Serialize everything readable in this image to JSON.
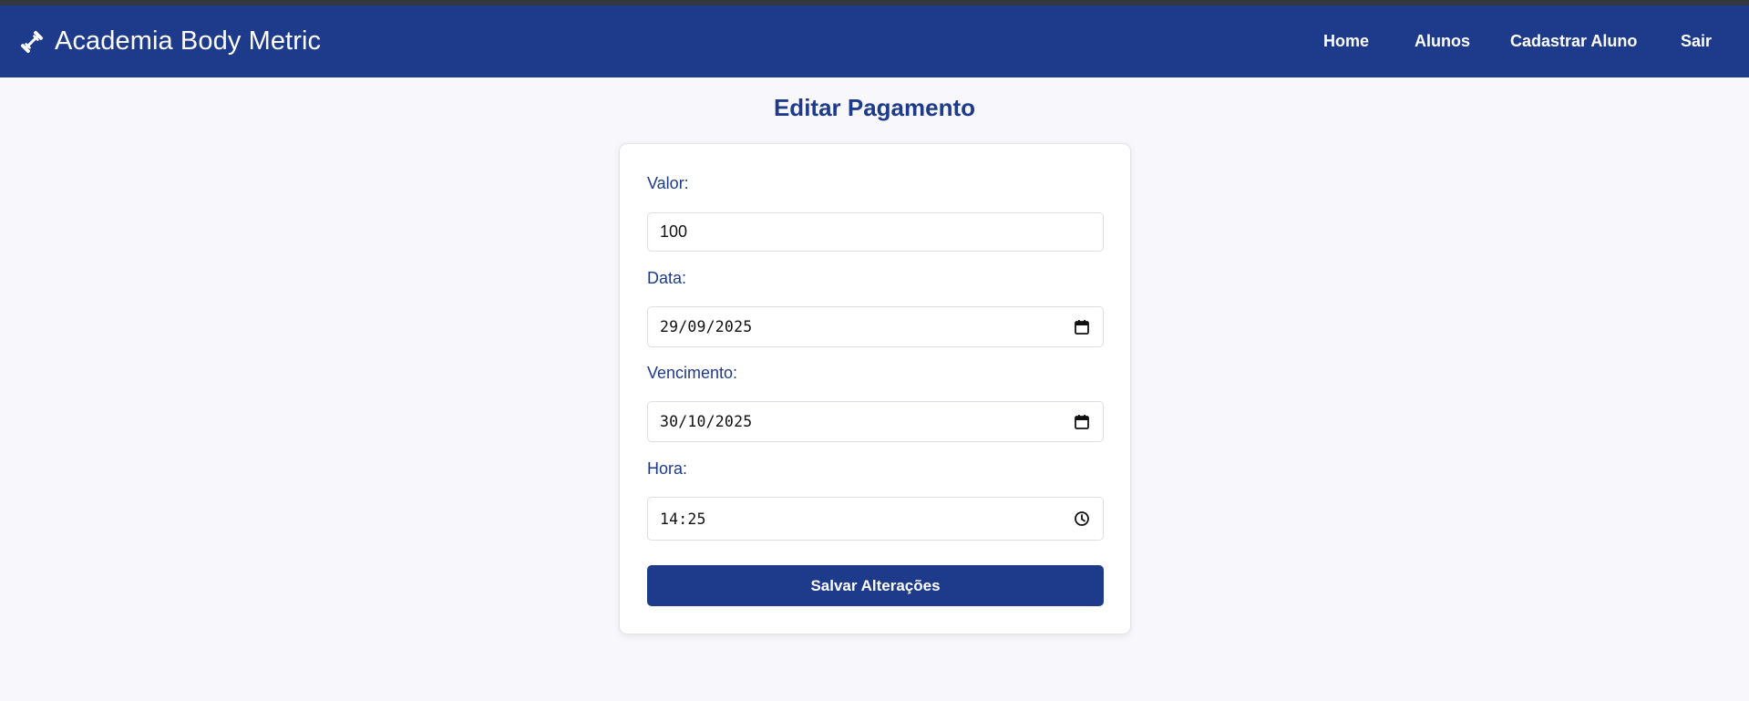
{
  "brand": {
    "title": "Academia Body Metric",
    "icon": "dumbbell-icon"
  },
  "nav": {
    "home": "Home",
    "alunos": "Alunos",
    "cadastrar": "Cadastrar Aluno",
    "sair": "Sair"
  },
  "page": {
    "title": "Editar Pagamento"
  },
  "form": {
    "valor": {
      "label": "Valor:",
      "value": "100"
    },
    "data": {
      "label": "Data:",
      "value": "29/09/2025",
      "icon": "calendar-icon"
    },
    "vencimento": {
      "label": "Vencimento:",
      "value": "30/10/2025",
      "icon": "calendar-icon"
    },
    "hora": {
      "label": "Hora:",
      "value": "14:25",
      "icon": "clock-icon"
    },
    "submit_label": "Salvar Alterações"
  },
  "colors": {
    "primary": "#1e3a8a",
    "background": "#f8f8fc",
    "card": "#ffffff"
  }
}
